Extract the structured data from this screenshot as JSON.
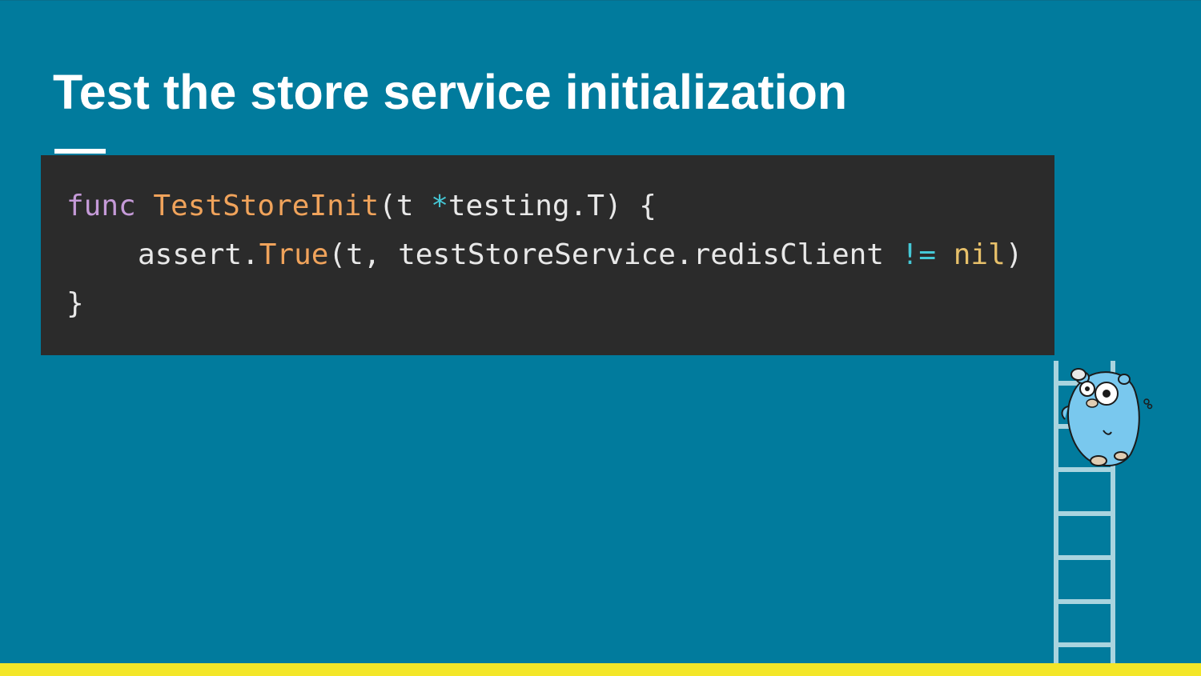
{
  "slide": {
    "title": "Test the store service initialization"
  },
  "code": {
    "line1": {
      "keyword": "func",
      "func_name": "TestStoreInit",
      "params": "(t ",
      "pointer": "*",
      "param_type": "testing.T) {"
    },
    "line2": {
      "receiver": "assert.",
      "method": "True",
      "args": "(t, testStoreService.redisClient ",
      "operator": "!=",
      "space": " ",
      "literal": "nil",
      "close": ")"
    },
    "line3": {
      "brace": "}"
    }
  },
  "colors": {
    "background": "#017b9d",
    "code_background": "#2b2b2b",
    "accent_bar": "#f3e628",
    "keyword": "#c59ad8",
    "function": "#f0a35b",
    "operator": "#45c8d6",
    "literal": "#e7c06a"
  },
  "illustration": {
    "icon": "gopher-climbing-ladder-icon"
  }
}
